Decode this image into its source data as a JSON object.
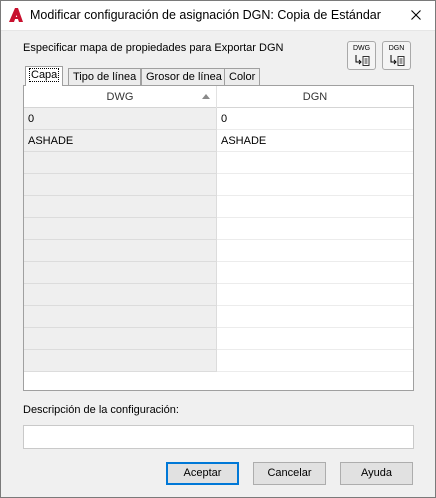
{
  "window": {
    "title": "Modificar configuración de asignación DGN: Copia de Estándar",
    "app_icon": "autocad-a-icon",
    "accent_color": "#c8102e"
  },
  "header": {
    "label": "Especificar mapa de propiedades para Exportar DGN",
    "tools": [
      {
        "label": "DWG",
        "icon": "import-from-dwg-icon"
      },
      {
        "label": "DGN",
        "icon": "import-from-dgn-icon"
      }
    ]
  },
  "tabs": [
    {
      "label": "Capa",
      "active": true
    },
    {
      "label": "Tipo de línea",
      "active": false
    },
    {
      "label": "Grosor de línea",
      "active": false
    },
    {
      "label": "Color",
      "active": false
    }
  ],
  "grid": {
    "columns": [
      "DWG",
      "DGN"
    ],
    "sort_column": "DWG",
    "rows": [
      [
        "0",
        "0"
      ],
      [
        "ASHADE",
        "ASHADE"
      ],
      [
        "",
        ""
      ],
      [
        "",
        ""
      ],
      [
        "",
        ""
      ],
      [
        "",
        ""
      ],
      [
        "",
        ""
      ],
      [
        "",
        ""
      ],
      [
        "",
        ""
      ],
      [
        "",
        ""
      ],
      [
        "",
        ""
      ],
      [
        "",
        ""
      ]
    ]
  },
  "description": {
    "label": "Descripción de la configuración:",
    "value": ""
  },
  "buttons": {
    "accept": "Aceptar",
    "cancel": "Cancelar",
    "help": "Ayuda"
  }
}
